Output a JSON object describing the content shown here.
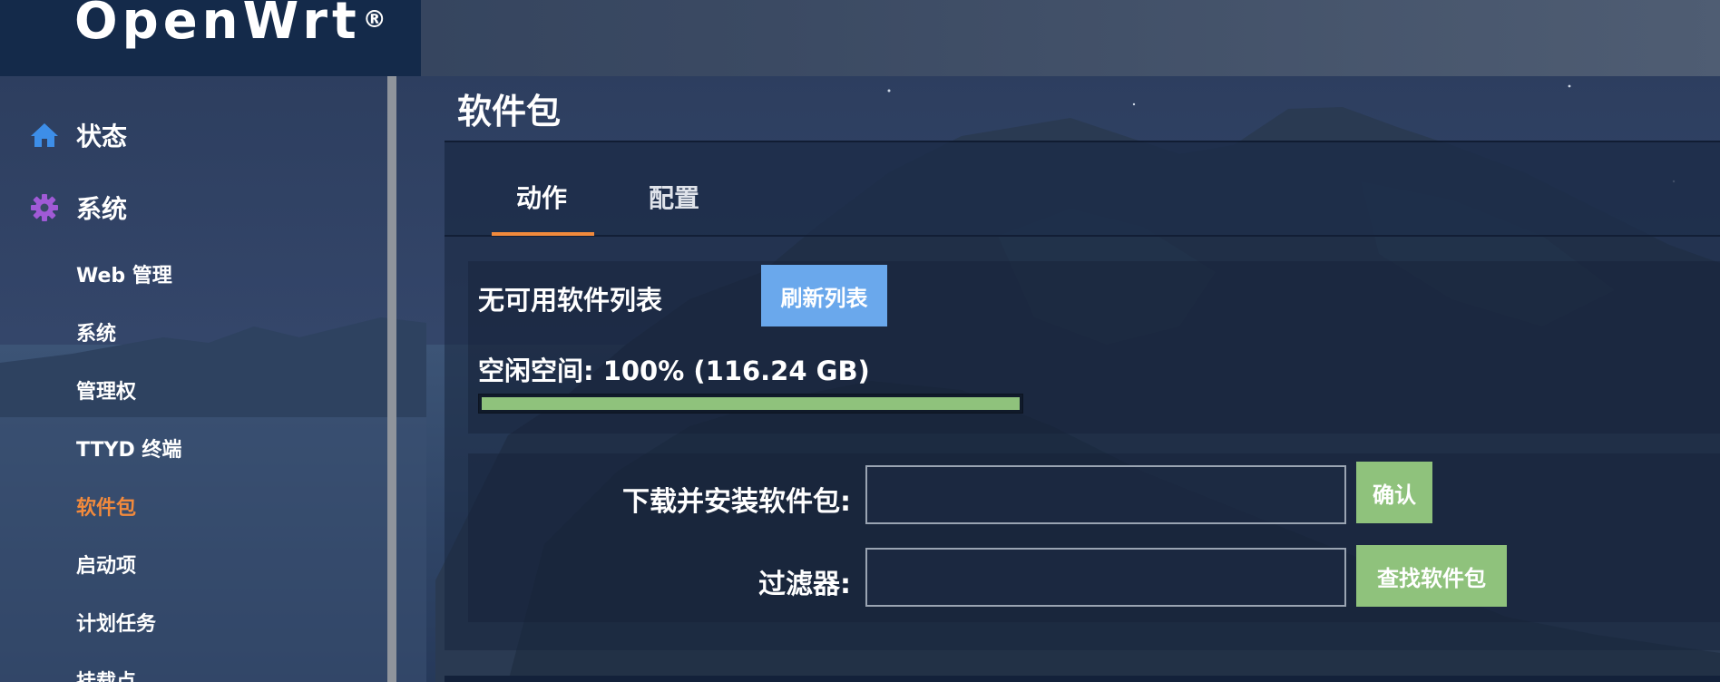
{
  "brand": {
    "name": "OpenWrt",
    "mark": "®"
  },
  "sidebar": {
    "groups": [
      {
        "label": "状态",
        "icon": "home-icon",
        "color": "#3d8ee8"
      },
      {
        "label": "系统",
        "icon": "gear-icon",
        "color": "#a05ad6"
      }
    ],
    "items": [
      {
        "label": "Web 管理"
      },
      {
        "label": "系统"
      },
      {
        "label": "管理权"
      },
      {
        "label": "TTYD 终端"
      },
      {
        "label": "软件包",
        "active": true
      },
      {
        "label": "启动项"
      },
      {
        "label": "计划任务"
      },
      {
        "label": "挂载点"
      }
    ]
  },
  "main": {
    "title": "软件包",
    "tabs": [
      {
        "label": "动作",
        "active": true
      },
      {
        "label": "配置",
        "active": false
      }
    ],
    "status": {
      "no_list": "无可用软件列表",
      "refresh_button": "刷新列表",
      "free_space": "空闲空间: 100% (116.24 GB)",
      "free_space_fraction": 1.0
    },
    "form": {
      "download_label": "下载并安装软件包:",
      "download_value": "",
      "confirm_button": "确认",
      "filter_label": "过滤器:",
      "filter_value": "",
      "find_button": "查找软件包"
    }
  },
  "colors": {
    "accent_orange": "#f28a3c",
    "button_blue": "#6aa8ec",
    "button_green": "#8fc27c"
  }
}
